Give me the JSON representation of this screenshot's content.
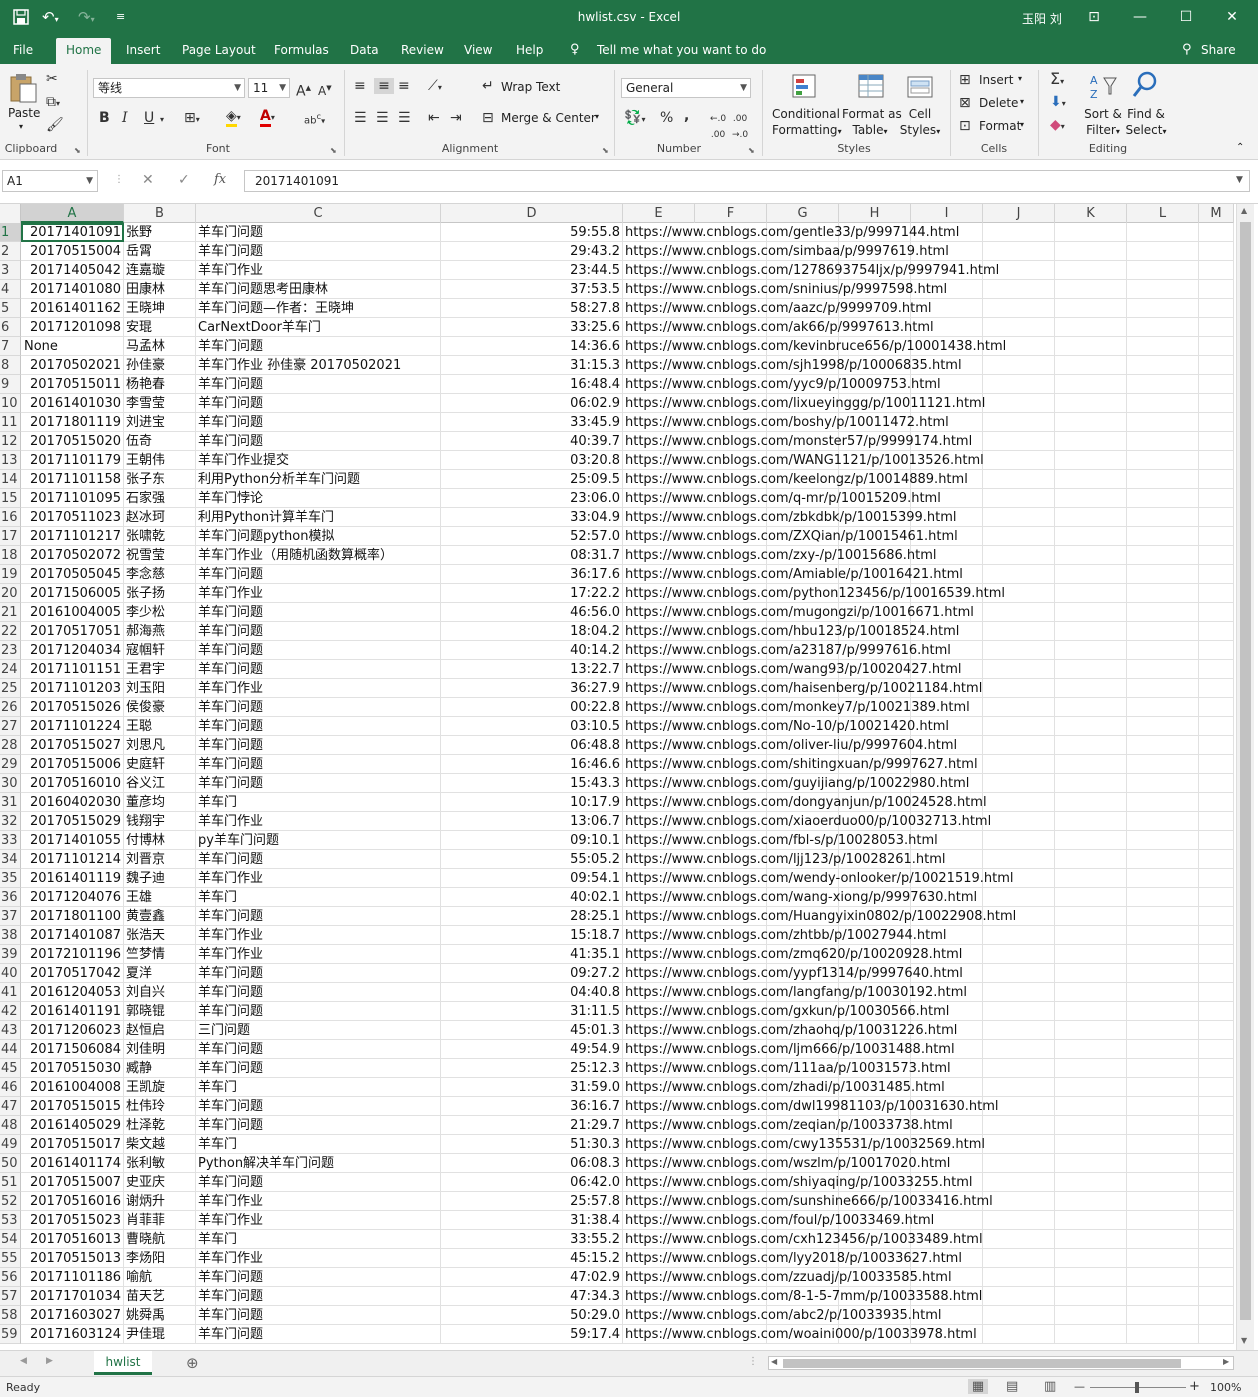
{
  "titlebar": {
    "title": "hwlist.csv  -  Excel",
    "user": "玉阳 刘",
    "save_icon": "save-icon",
    "undo_icon": "undo-icon",
    "redo_icon": "redo-icon",
    "minimize": "—",
    "restore": "☐",
    "close": "✕",
    "ribbon_display": "⊡"
  },
  "menu": {
    "tabs": [
      "File",
      "Home",
      "Insert",
      "Page Layout",
      "Formulas",
      "Data",
      "Review",
      "View",
      "Help"
    ],
    "active": "Home",
    "tell_me": "Tell me what you want to do",
    "share": "Share"
  },
  "ribbon": {
    "clipboard": {
      "paste": "Paste",
      "label": "Clipboard"
    },
    "font": {
      "name": "等线",
      "size": "11",
      "bold": "B",
      "italic": "I",
      "underline": "U",
      "label": "Font"
    },
    "alignment": {
      "wrap_text": "Wrap Text",
      "merge_center": "Merge & Center",
      "label": "Alignment"
    },
    "number": {
      "format": "General",
      "percent": "%",
      "comma": ",",
      "label": "Number"
    },
    "styles": {
      "conditional": [
        "Conditional",
        "Formatting"
      ],
      "format_table": [
        "Format as",
        "Table"
      ],
      "cell_styles": [
        "Cell",
        "Styles"
      ],
      "label": "Styles"
    },
    "cells": {
      "insert": "Insert",
      "delete": "Delete",
      "format": "Format",
      "label": "Cells"
    },
    "editing": {
      "sort_filter": [
        "Sort &",
        "Filter"
      ],
      "find_select": [
        "Find &",
        "Select"
      ],
      "label": "Editing"
    }
  },
  "formula_bar": {
    "name_box": "A1",
    "cancel": "✕",
    "enter": "✓",
    "fx": "fx",
    "value": "20171401091"
  },
  "columns": [
    "A",
    "B",
    "C",
    "D",
    "E",
    "F",
    "G",
    "H",
    "I",
    "J",
    "K",
    "L",
    "M"
  ],
  "rows": [
    [
      "20171401091",
      "张野",
      "羊车门问题",
      "59:55.8",
      "https://www.cnblogs.com/gentle33/p/9997144.html"
    ],
    [
      "20170515004",
      "岳霄",
      "羊车门问题",
      "29:43.2",
      "https://www.cnblogs.com/simbaa/p/9997619.html"
    ],
    [
      "20171405042",
      "连嘉璇",
      "羊车门作业",
      "23:44.5",
      "https://www.cnblogs.com/1278693754ljx/p/9997941.html"
    ],
    [
      "20171401080",
      "田康林",
      "羊车门问题思考田康林",
      "37:53.5",
      "https://www.cnblogs.com/sninius/p/9997598.html"
    ],
    [
      "20161401162",
      "王晓坤",
      "羊车门问题—作者：王晓坤",
      "58:27.8",
      "https://www.cnblogs.com/aazc/p/9999709.html"
    ],
    [
      "20171201098",
      "安琨",
      "CarNextDoor羊车门",
      "33:25.6",
      "https://www.cnblogs.com/ak66/p/9997613.html"
    ],
    [
      "None",
      "马孟林",
      "羊车门问题",
      "14:36.6",
      "https://www.cnblogs.com/kevinbruce656/p/10001438.html"
    ],
    [
      "20170502021",
      "孙佳豪",
      "羊车门作业 孙佳豪 20170502021",
      "31:15.3",
      "https://www.cnblogs.com/sjh1998/p/10006835.html"
    ],
    [
      "20170515011",
      "杨艳春",
      "羊车门问题",
      "16:48.4",
      "https://www.cnblogs.com/yyc9/p/10009753.html"
    ],
    [
      "20161401030",
      "李雪莹",
      "羊车门问题",
      "06:02.9",
      "https://www.cnblogs.com/lixueyinggg/p/10011121.html"
    ],
    [
      "20171801119",
      "刘进宝",
      "羊车门问题",
      "33:45.9",
      "https://www.cnblogs.com/boshy/p/10011472.html"
    ],
    [
      "20170515020",
      "伍奇",
      "羊车门问题",
      "40:39.7",
      "https://www.cnblogs.com/monster57/p/9999174.html"
    ],
    [
      "20171101179",
      "王朝伟",
      "羊车门作业提交",
      "03:20.8",
      "https://www.cnblogs.com/WANG1121/p/10013526.html"
    ],
    [
      "20171101158",
      "张子东",
      "利用Python分析羊车门问题",
      "25:09.5",
      "https://www.cnblogs.com/keelongz/p/10014889.html"
    ],
    [
      "20171101095",
      "石家强",
      "羊车门悖论",
      "23:06.0",
      "https://www.cnblogs.com/q-mr/p/10015209.html"
    ],
    [
      "20170511023",
      "赵冰珂",
      "利用Python计算羊车门",
      "33:04.9",
      "https://www.cnblogs.com/zbkdbk/p/10015399.html"
    ],
    [
      "20171101217",
      "张啸乾",
      "羊车门问题python模拟",
      "52:57.0",
      "https://www.cnblogs.com/ZXQian/p/10015461.html"
    ],
    [
      "20170502072",
      "祝雪莹",
      "羊车门作业（用随机函数算概率）",
      "08:31.7",
      "https://www.cnblogs.com/zxy-/p/10015686.html"
    ],
    [
      "20170505045",
      "李念慈",
      "羊车门问题",
      "36:17.6",
      "https://www.cnblogs.com/Amiable/p/10016421.html"
    ],
    [
      "20171506005",
      "张子扬",
      "羊车门作业",
      "17:22.2",
      "https://www.cnblogs.com/python123456/p/10016539.html"
    ],
    [
      "20161004005",
      "李少松",
      "羊车门问题",
      "46:56.0",
      "https://www.cnblogs.com/mugongzi/p/10016671.html"
    ],
    [
      "20170517051",
      "郝海燕",
      "羊车门问题",
      "18:04.2",
      "https://www.cnblogs.com/hbu123/p/10018524.html"
    ],
    [
      "20171204034",
      "寇帼轩",
      "羊车门问题",
      "40:14.2",
      "https://www.cnblogs.com/a23187/p/9997616.html"
    ],
    [
      "20171101151",
      "王君宇",
      "羊车门问题",
      "13:22.7",
      "https://www.cnblogs.com/wang93/p/10020427.html"
    ],
    [
      "20171101203",
      "刘玉阳",
      "羊车门作业",
      "36:27.9",
      "https://www.cnblogs.com/haisenberg/p/10021184.html"
    ],
    [
      "20170515026",
      "侯俊豪",
      "羊车门问题",
      "00:22.8",
      "https://www.cnblogs.com/monkey7/p/10021389.html"
    ],
    [
      "20171101224",
      "王聪",
      "羊车门问题",
      "03:10.5",
      "https://www.cnblogs.com/No-10/p/10021420.html"
    ],
    [
      "20170515027",
      "刘思凡",
      "羊车门问题",
      "06:48.8",
      "https://www.cnblogs.com/oliver-liu/p/9997604.html"
    ],
    [
      "20170515006",
      "史庭轩",
      "羊车门问题",
      "16:46.6",
      "https://www.cnblogs.com/shitingxuan/p/9997627.html"
    ],
    [
      "20170516010",
      "谷义江",
      "羊车门问题",
      "15:43.3",
      "https://www.cnblogs.com/guyijiang/p/10022980.html"
    ],
    [
      "20160402030",
      "董彦均",
      "羊车门",
      "10:17.9",
      "https://www.cnblogs.com/dongyanjun/p/10024528.html"
    ],
    [
      "20170515029",
      "钱翔宇",
      "羊车门作业",
      "13:06.7",
      "https://www.cnblogs.com/xiaoerduo00/p/10032713.html"
    ],
    [
      "20171401055",
      "付博林",
      "py羊车门问题",
      "09:10.1",
      "https://www.cnblogs.com/fbl-s/p/10028053.html"
    ],
    [
      "20171101214",
      "刘晋京",
      "羊车门问题",
      "55:05.2",
      "https://www.cnblogs.com/ljj123/p/10028261.html"
    ],
    [
      "20161401119",
      "魏子迪",
      "羊车门作业",
      "09:54.1",
      "https://www.cnblogs.com/wendy-onlooker/p/10021519.html"
    ],
    [
      "20171204076",
      "王雄",
      "羊车门",
      "40:02.1",
      "https://www.cnblogs.com/wang-xiong/p/9997630.html"
    ],
    [
      "20171801100",
      "黄壹鑫",
      "羊车门问题",
      "28:25.1",
      "https://www.cnblogs.com/Huangyixin0802/p/10022908.html"
    ],
    [
      "20171401087",
      "张浩天",
      "羊车门作业",
      "15:18.7",
      "https://www.cnblogs.com/zhtbb/p/10027944.html"
    ],
    [
      "20172101196",
      "竺梦情",
      "羊车门作业",
      "41:35.1",
      "https://www.cnblogs.com/zmq620/p/10020928.html"
    ],
    [
      "20170517042",
      "夏洋",
      "羊车门问题",
      "09:27.2",
      "https://www.cnblogs.com/yypf1314/p/9997640.html"
    ],
    [
      "20161204053",
      "刘自兴",
      "羊车门问题",
      "04:40.8",
      "https://www.cnblogs.com/langfang/p/10030192.html"
    ],
    [
      "20161401191",
      "郭晓锟",
      "羊车门问题",
      "31:11.5",
      "https://www.cnblogs.com/gxkun/p/10030566.html"
    ],
    [
      "20171206023",
      "赵恒启",
      "三门问题",
      "45:01.3",
      "https://www.cnblogs.com/zhaohq/p/10031226.html"
    ],
    [
      "20171506084",
      "刘佳明",
      "羊车门问题",
      "49:54.9",
      "https://www.cnblogs.com/ljm666/p/10031488.html"
    ],
    [
      "20170515030",
      "臧静",
      "羊车门问题",
      "25:12.3",
      "https://www.cnblogs.com/111aa/p/10031573.html"
    ],
    [
      "20161004008",
      "王凯旋",
      "羊车门",
      "31:59.0",
      "https://www.cnblogs.com/zhadi/p/10031485.html"
    ],
    [
      "20170515015",
      "杜伟玲",
      "羊车门问题",
      "36:16.7",
      "https://www.cnblogs.com/dwl19981103/p/10031630.html"
    ],
    [
      "20161405029",
      "杜泽乾",
      "羊车门问题",
      "21:29.7",
      "https://www.cnblogs.com/zeqian/p/10033738.html"
    ],
    [
      "20170515017",
      "柴文越",
      "羊车门",
      "51:30.3",
      "https://www.cnblogs.com/cwy135531/p/10032569.html"
    ],
    [
      "20161401174",
      "张利敏",
      "Python解决羊车门问题",
      "06:08.3",
      "https://www.cnblogs.com/wszlm/p/10017020.html"
    ],
    [
      "20170515007",
      "史亚庆",
      "羊车门问题",
      "06:42.0",
      "https://www.cnblogs.com/shiyaqing/p/10033255.html"
    ],
    [
      "20170516016",
      "谢炳升",
      "羊车门作业",
      "25:57.8",
      "https://www.cnblogs.com/sunshine666/p/10033416.html"
    ],
    [
      "20170515023",
      "肖菲菲",
      "羊车门作业",
      "31:38.4",
      "https://www.cnblogs.com/foul/p/10033469.html"
    ],
    [
      "20170516013",
      "曹晓航",
      "羊车门",
      "33:55.2",
      "https://www.cnblogs.com/cxh123456/p/10033489.html"
    ],
    [
      "20170515013",
      "李炀阳",
      "羊车门作业",
      "45:15.2",
      "https://www.cnblogs.com/lyy2018/p/10033627.html"
    ],
    [
      "20171101186",
      "喻航",
      "羊车门问题",
      "47:02.9",
      "https://www.cnblogs.com/zzuadj/p/10033585.html"
    ],
    [
      "20171701034",
      "苗天艺",
      "羊车门问题",
      "47:34.3",
      "https://www.cnblogs.com/8-1-5-7mm/p/10033588.html"
    ],
    [
      "20171603027",
      "姚舜禹",
      "羊车门问题",
      "50:29.0",
      "https://www.cnblogs.com/abc2/p/10033935.html"
    ],
    [
      "20171603124",
      "尹佳琨",
      "羊车门问题",
      "59:17.4",
      "https://www.cnblogs.com/woaini000/p/10033978.html"
    ]
  ],
  "sheet": {
    "name": "hwlist",
    "add": "⊕"
  },
  "status": {
    "text": "Ready",
    "zoom": "100%",
    "zoom_minus": "—",
    "zoom_plus": "+"
  },
  "colors": {
    "accent": "#217346"
  }
}
